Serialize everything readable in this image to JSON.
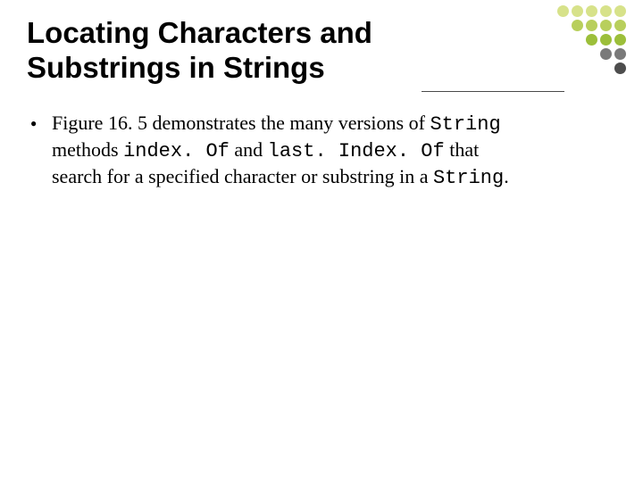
{
  "title_line1": "Locating Characters and",
  "title_line2": "Substrings in Strings",
  "bullet": {
    "seg1": "Figure 16. 5 demonstrates the many versions of ",
    "mono1": "String",
    "seg2": " methods ",
    "mono2": "index. Of",
    "seg3": " and ",
    "mono3": "last. Index. Of",
    "seg4": " that search for a specified character or substring in a ",
    "mono4": "String",
    "seg5": "."
  },
  "dot_colors": {
    "r1": [
      "#d7e28a",
      "#d7e28a",
      "#d7e28a",
      "#d7e28a",
      "#d7e28a"
    ],
    "r2": [
      "#ffffff",
      "#b8cf5c",
      "#b8cf5c",
      "#b8cf5c",
      "#b8cf5c"
    ],
    "r3": [
      "#ffffff",
      "#ffffff",
      "#9cbf3a",
      "#9cbf3a",
      "#9cbf3a"
    ],
    "r4": [
      "#ffffff",
      "#ffffff",
      "#ffffff",
      "#7a7a7a",
      "#7a7a7a"
    ],
    "r5": [
      "#ffffff",
      "#ffffff",
      "#ffffff",
      "#ffffff",
      "#4d4d4d"
    ]
  }
}
